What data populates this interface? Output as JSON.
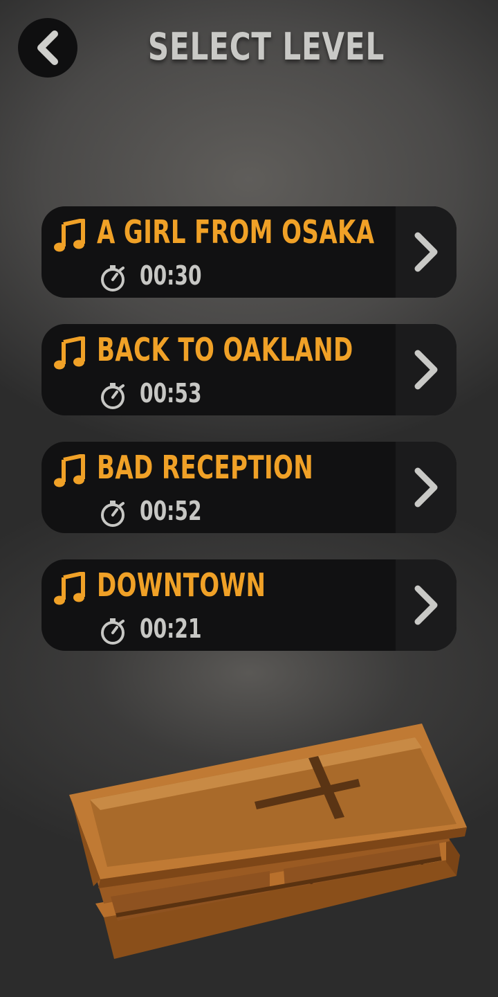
{
  "header": {
    "title": "SELECT LEVEL",
    "back_icon": "chevron-left-icon"
  },
  "levels": [
    {
      "name": "A GIRL FROM OSAKA",
      "time": "00:30"
    },
    {
      "name": "BACK TO OAKLAND",
      "time": "00:53"
    },
    {
      "name": "BAD RECEPTION",
      "time": "00:52"
    },
    {
      "name": "DOWNTOWN",
      "time": "00:21"
    }
  ],
  "icons": {
    "level": "music-note-icon",
    "time": "stopwatch-icon",
    "play": "chevron-right-icon",
    "decoration": "coffin-illustration"
  },
  "colors": {
    "accent": "#f0a127",
    "text_secondary": "#c7c7c4",
    "card": "#111112",
    "background": "#4a4948"
  }
}
